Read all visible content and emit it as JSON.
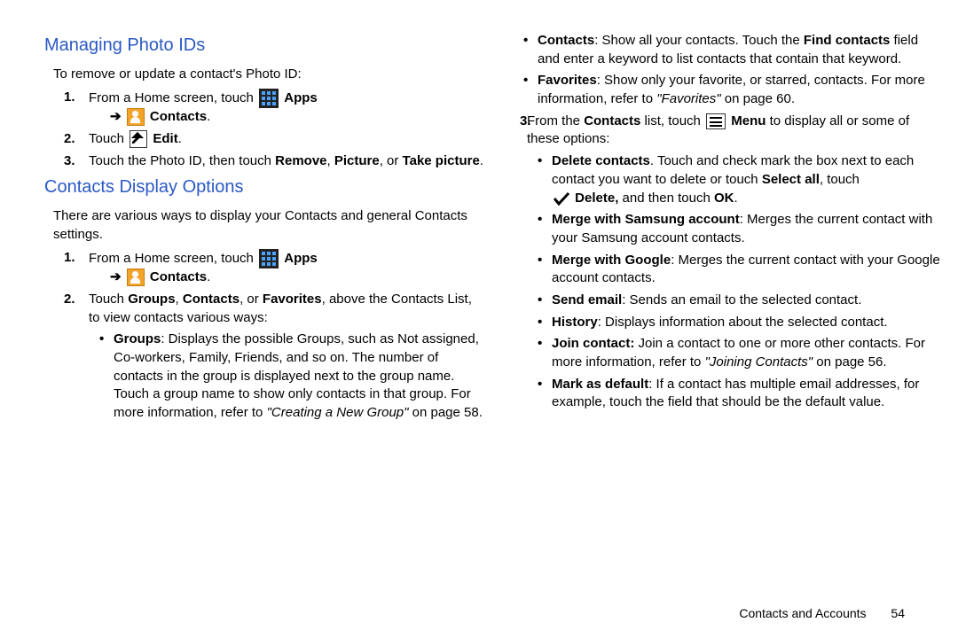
{
  "left": {
    "heading1": "Managing Photo IDs",
    "intro1": "To remove or update a contact's Photo ID:",
    "step1a": "From a Home screen, touch",
    "apps": "Apps",
    "contacts": "Contacts",
    "period": ".",
    "step2a": "Touch",
    "edit": "Edit",
    "step3a": "Touch the Photo ID, then touch ",
    "remove": "Remove",
    "comma": ", ",
    "picture": "Picture",
    "or": ", or ",
    "takepic": "Take picture",
    "heading2": "Contacts Display Options",
    "intro2": "There are various ways to display your Contacts and general Contacts settings.",
    "cdo_step1": "From a Home screen, touch",
    "cdo_step2a": "Touch ",
    "groups": "Groups",
    "contactsB": "Contacts",
    "favorites": "Favorites",
    "cdo_step2b": ", above the Contacts List, to view contacts various ways:",
    "bul_groups": "Groups",
    "bul_groups_txt": ": Displays the possible Groups, such as Not assigned, Co-workers, Family, Friends, and so on. The number of contacts in the group is displayed next to the group name. Touch a group name to show only contacts in that group. For more information, refer to ",
    "bul_groups_ref": "\"Creating a New Group\"",
    "bul_groups_end": " on page 58."
  },
  "right": {
    "bul_contacts": "Contacts",
    "bul_contacts_txt": ": Show all your contacts. Touch the ",
    "find": "Find contacts",
    "bul_contacts_txt2": " field and enter a keyword to list contacts that contain that keyword.",
    "bul_fav": "Favorites",
    "bul_fav_txt": ": Show only your favorite, or starred, contacts. For more information, refer to ",
    "bul_fav_ref": "\"Favorites\"",
    "bul_fav_end": " on page 60.",
    "step3a": "From the ",
    "contactsB": "Contacts",
    "step3b": " list, touch ",
    "menu": "Menu",
    "step3c": " to display all or some of these options:",
    "opt_del": "Delete contacts",
    "opt_del_txt": ". Touch and check mark the box next to each contact you want to delete or touch ",
    "selectall": "Select all",
    "opt_del_txt2": ", touch",
    "delete": "Delete,",
    "opt_del_txt3": " and then touch ",
    "ok": "OK",
    "opt_merge_s": "Merge with Samsung account",
    "opt_merge_s_txt": ": Merges the current contact with your Samsung account contacts.",
    "opt_merge_g": "Merge with Google",
    "opt_merge_g_txt": ": Merges the current contact with your Google account contacts.",
    "opt_send": "Send email",
    "opt_send_txt": ": Sends an email to the selected contact.",
    "opt_hist": "History",
    "opt_hist_txt": ": Displays information about the selected contact.",
    "opt_join": "Join contact:",
    "opt_join_txt": " Join a contact to one or more other contacts. For more information, refer to ",
    "opt_join_ref": "\"Joining Contacts\"",
    "opt_join_end": " on page 56.",
    "opt_mark": "Mark as default",
    "opt_mark_txt": ": If a contact has multiple email addresses, for example, touch the field that should be the default value."
  },
  "footer": {
    "section": "Contacts and Accounts",
    "page": "54"
  }
}
